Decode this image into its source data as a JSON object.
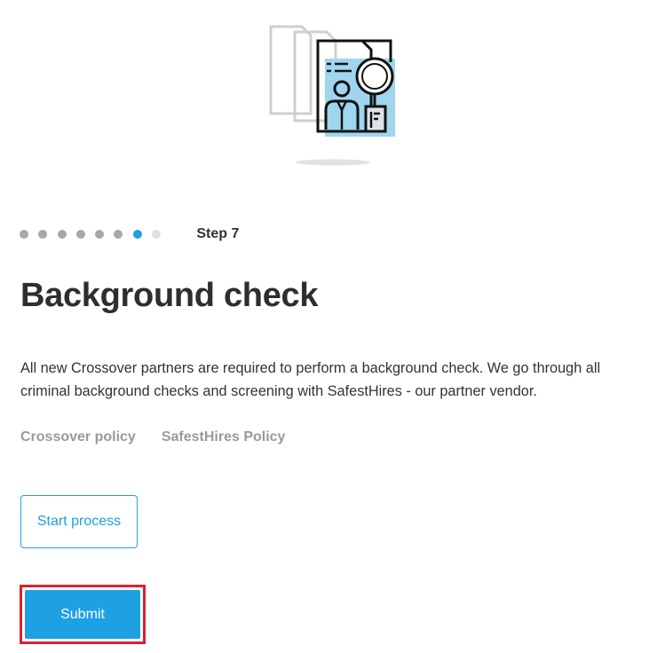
{
  "illustration": {
    "icon": "background-check-document-magnifier-icon",
    "accent_color": "#9fd6ee",
    "line_color": "#111111",
    "ghost_color": "#cfcfcf"
  },
  "stepper": {
    "total_dots": 8,
    "current_index": 6,
    "step_label": "Step 7",
    "colors": {
      "completed": "#a8a8a8",
      "active": "#1da1e2",
      "future": "#dde1e5"
    }
  },
  "page": {
    "title": "Background check",
    "description": "All new Crossover partners are required to perform a background check. We go through all criminal background checks and screening with SafestHires - our partner vendor."
  },
  "links": {
    "crossover_policy": "Crossover policy",
    "safesthires_policy": "SafestHires Policy"
  },
  "actions": {
    "start_process_label": "Start process",
    "submit_label": "Submit"
  },
  "colors": {
    "accent": "#1da1e2",
    "highlight": "#e0202e"
  }
}
